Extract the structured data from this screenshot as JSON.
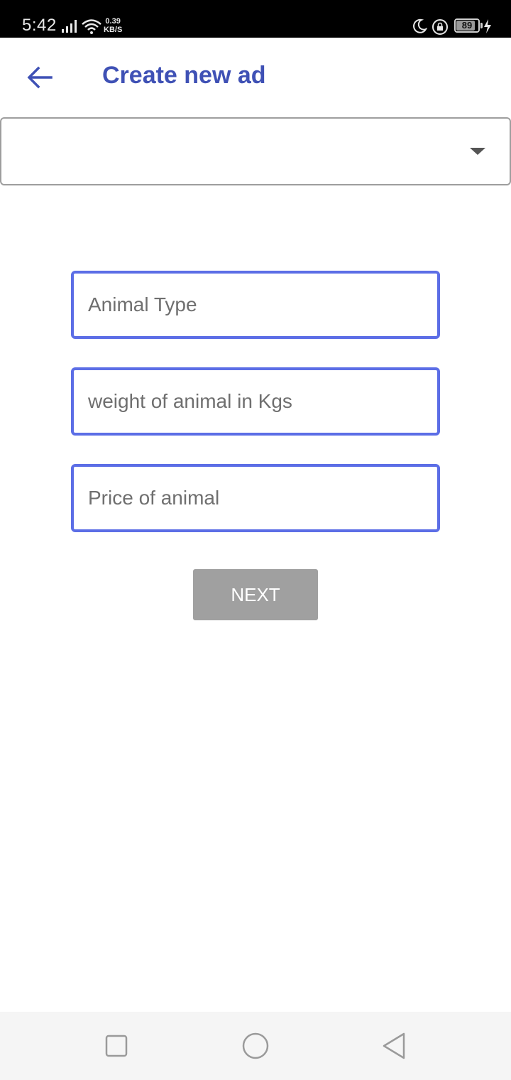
{
  "status_bar": {
    "time": "5:42",
    "net_speed_value": "0.39",
    "net_speed_unit": "KB/S",
    "battery_level": "89",
    "battery_percent": 89,
    "icons": [
      "signal-icon",
      "wifi-icon",
      "moon-icon",
      "lock-icon",
      "battery-icon",
      "charging-bolt-icon"
    ]
  },
  "app_bar": {
    "title": "Create new ad",
    "back_icon": "arrow-left-icon"
  },
  "category_dropdown": {
    "selected": ""
  },
  "form": {
    "animal_type": {
      "placeholder": "Animal Type",
      "value": ""
    },
    "weight": {
      "placeholder": "weight of animal in Kgs",
      "value": ""
    },
    "price": {
      "placeholder": "Price of animal",
      "value": ""
    },
    "next_label": "NEXT"
  },
  "nav_bar": {
    "icons": [
      "recents-square-icon",
      "home-circle-icon",
      "back-triangle-icon"
    ]
  },
  "colors": {
    "accent": "#3f51b5",
    "field_border": "#5c6ee6",
    "button_disabled": "#a0a0a0",
    "status_bar": "#000000"
  }
}
